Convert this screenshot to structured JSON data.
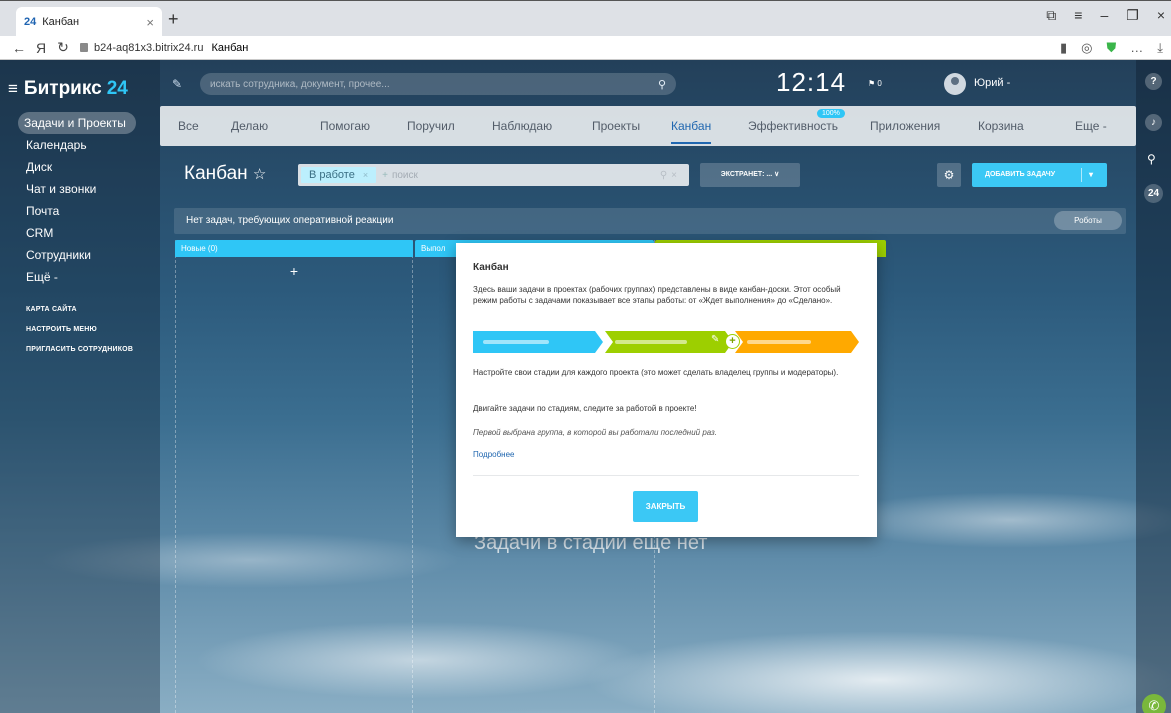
{
  "browser": {
    "tab_title": "Канбан",
    "tab_favicon": "24",
    "url": "b24-aq81x3.bitrix24.ru",
    "page_title": "Канбан"
  },
  "sidebar": {
    "logo_text": "Битрикс",
    "logo_num": "24",
    "items": [
      {
        "label": "Задачи и Проекты"
      },
      {
        "label": "Календарь"
      },
      {
        "label": "Диск"
      },
      {
        "label": "Чат и звонки"
      },
      {
        "label": "Почта"
      },
      {
        "label": "CRM"
      },
      {
        "label": "Сотрудники"
      },
      {
        "label": "Ещё -"
      }
    ],
    "small_items": [
      {
        "label": "КАРТА САЙТА"
      },
      {
        "label": "НАСТРОИТЬ МЕНЮ"
      },
      {
        "label": "ПРИГЛАСИТЬ СОТРУДНИКОВ"
      }
    ]
  },
  "header": {
    "search_placeholder": "искать сотрудника, документ, прочее...",
    "clock": "12:14",
    "flag_count": "0",
    "user_name": "Юрий -"
  },
  "tabs": {
    "items": [
      {
        "label": "Все"
      },
      {
        "label": "Делаю"
      },
      {
        "label": "Помогаю"
      },
      {
        "label": "Поручил"
      },
      {
        "label": "Наблюдаю"
      },
      {
        "label": "Проекты"
      },
      {
        "label": "Канбан"
      },
      {
        "label": "Эффективность"
      },
      {
        "label": "Приложения"
      },
      {
        "label": "Корзина"
      },
      {
        "label": "Еще -"
      }
    ],
    "active": "Канбан",
    "badge": "100%"
  },
  "toolbar": {
    "title": "Канбан",
    "filter_chip": "В работе",
    "filter_placeholder": "поиск",
    "extranet_label": "ЭКСТРАНЕТ: ...",
    "add_task_label": "ДОБАВИТЬ ЗАДАЧУ"
  },
  "status": {
    "text": "Нет задач, требующих оперативной реакции",
    "robots_label": "Роботы"
  },
  "columns": [
    {
      "title": "Новые (0)",
      "color": "#2fc6f6"
    },
    {
      "title": "Выпол",
      "color": "#2fc6f6"
    },
    {
      "title": "",
      "color": "#9dcf00"
    }
  ],
  "empty_text": "Задачи в стадии ещё нет",
  "popup": {
    "title": "Канбан",
    "p1": "Здесь ваши задачи в проектах (рабочих группах) представлены в виде канбан-доски. Этот особый режим работы с задачами показывает все этапы работы: от «Ждет выполнения» до «Сделано».",
    "p2": "Настройте свои стадии для каждого проекта (это может сделать владелец группы и модераторы).",
    "p3": "Двигайте задачи по стадиям, следите за работой в проекте!",
    "p4": "Первой выбрана группа, в которой вы работали последний раз.",
    "link": "Подробнее",
    "close_label": "ЗАКРЫТЬ"
  },
  "colors": {
    "accent_blue": "#2fc6f6",
    "accent_green": "#9dcf00",
    "accent_orange": "#ffa900",
    "link": "#2067b0"
  }
}
